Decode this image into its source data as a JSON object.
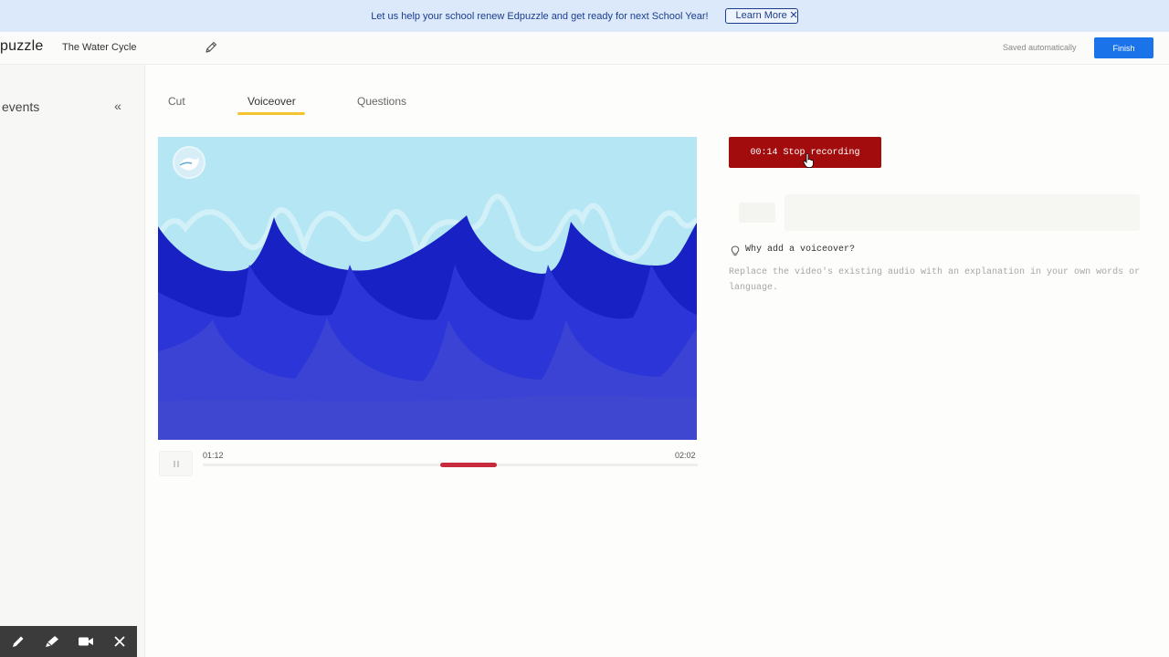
{
  "banner": {
    "text": "Let us help your school renew Edpuzzle and get ready for next School Year!",
    "button_label": "Learn More",
    "close_glyph": "×"
  },
  "header": {
    "logo": "puzzle",
    "video_title": "The Water Cycle",
    "edit_icon": "pencil-icon",
    "saved_status": "Saved automatically",
    "finish_label": "Finish"
  },
  "sidebar": {
    "label": "events",
    "collapse_glyph": "«"
  },
  "tabs": [
    {
      "label": "Cut",
      "active": false
    },
    {
      "label": "Voiceover",
      "active": true
    },
    {
      "label": "Questions",
      "active": false
    }
  ],
  "player": {
    "current_time": "01:12",
    "total_time": "02:02",
    "state": "paused",
    "recorded_segment": {
      "start_fraction": 0.48,
      "end_fraction": 0.595
    }
  },
  "recording": {
    "stop_label": "00:14 Stop recording"
  },
  "voiceover_info": {
    "title": "Why add a voiceover?",
    "description": "Replace the video's existing audio with an explanation in your own words or language."
  },
  "colors": {
    "accent_blue": "#1a73e8",
    "recording_red": "#a30c0c",
    "segment_red": "#c72a3c",
    "tab_underline": "#f2c530",
    "banner_bg": "#dce9fb"
  },
  "annotation_tools": [
    "pen-icon",
    "highlighter-icon",
    "camera-icon",
    "close-icon"
  ]
}
